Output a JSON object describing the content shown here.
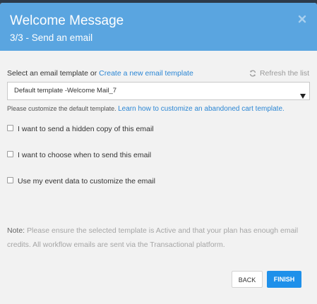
{
  "header": {
    "title": "Welcome Message",
    "subtitle": "3/3 - Send an email",
    "close_icon": "close-icon"
  },
  "template_row": {
    "label": "Select an email template or ",
    "create_link": "Create a new email template",
    "refresh_label": "Refresh the list",
    "refresh_icon": "refresh-icon"
  },
  "template_select": {
    "selected": "Default template -Welcome Mail_7",
    "caret_icon": "caret-down-icon"
  },
  "hint": {
    "text": "Please customize the default template. ",
    "link": "Learn how to customize an abandoned cart template."
  },
  "options": [
    {
      "label": "I want to send a hidden copy of this email",
      "checked": false
    },
    {
      "label": "I want to choose when to send this email",
      "checked": false
    },
    {
      "label": "Use my event data to customize the email",
      "checked": false
    }
  ],
  "note": {
    "label": "Note:",
    "text": " Please ensure the selected template is Active and that your plan has enough email credits. All workflow emails are sent via the Transactional platform."
  },
  "footer": {
    "back_label": "BACK",
    "finish_label": "FINISH"
  },
  "colors": {
    "header_bg": "#5aa5e0",
    "link": "#2b86d4",
    "primary_button": "#1e90ea",
    "body_bg": "#f2f2f2"
  }
}
